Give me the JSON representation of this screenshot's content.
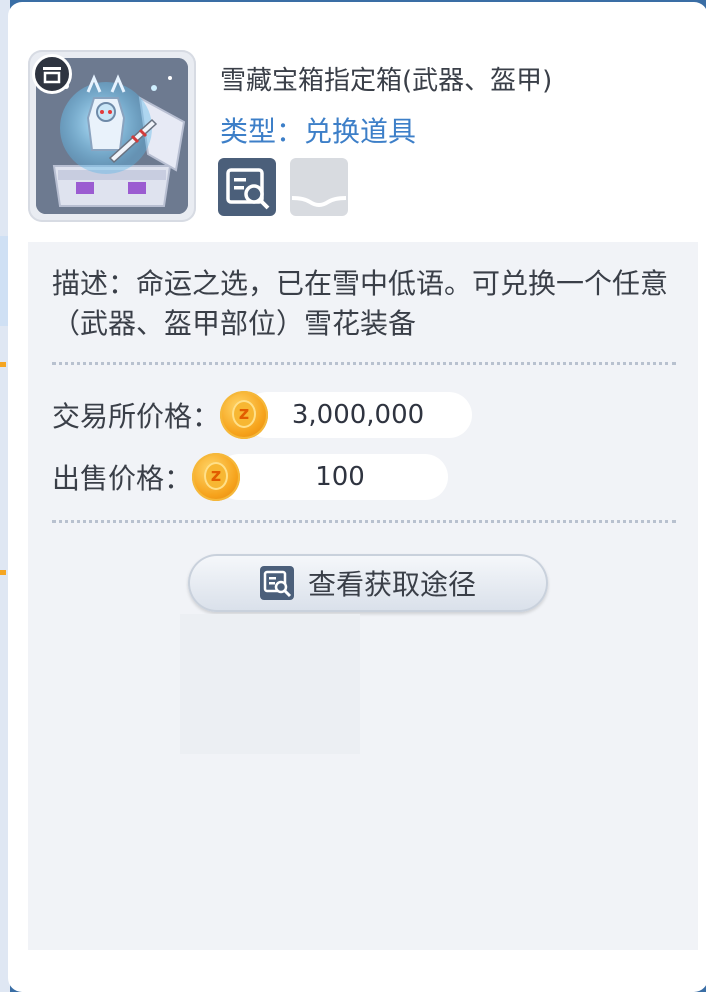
{
  "item": {
    "name": "雪藏宝箱指定箱(武器、盔甲)",
    "type": "类型：兑换道具",
    "icon": "treasure-chest-icon",
    "bound_icon": "bound-badge-icon"
  },
  "actions": {
    "detail_icon": "detail-search-icon",
    "empty_slot": "empty-slot-icon"
  },
  "description": "描述：命运之选，已在雪中低语。可兑换一个任意（武器、盔甲部位）雪花装备",
  "prices": {
    "exchange_label": "交易所价格：",
    "exchange_value": "3,000,000",
    "sell_label": "出售价格：",
    "sell_value": "100",
    "coin_icon": "zeny-coin-icon"
  },
  "route_button": {
    "label": "查看获取途径",
    "icon": "detail-search-icon"
  },
  "colors": {
    "type_text": "#3d7fc8",
    "coin": "#f6a31c",
    "panel_bg": "#f1f3f7"
  }
}
